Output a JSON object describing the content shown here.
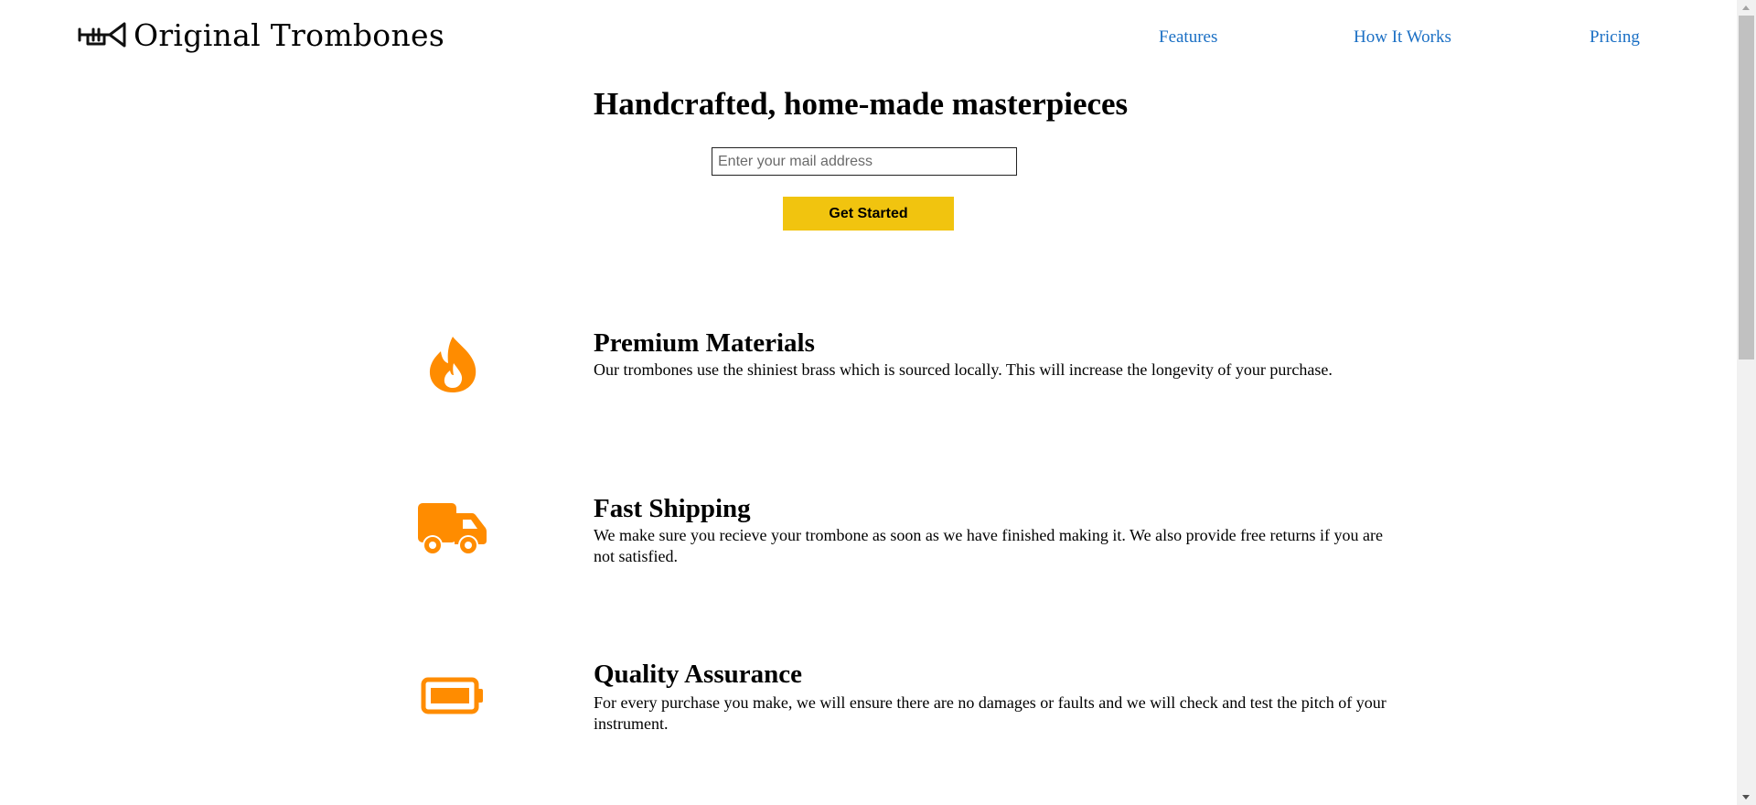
{
  "header": {
    "logo_text": "Original Trombones",
    "logo_icon": "trombone-icon",
    "nav": [
      {
        "label": "Features"
      },
      {
        "label": "How It Works"
      },
      {
        "label": "Pricing"
      }
    ]
  },
  "hero": {
    "title": "Handcrafted, home-made masterpieces",
    "email_placeholder": "Enter your mail address",
    "button_label": "Get Started"
  },
  "features": [
    {
      "icon": "fire-icon",
      "title": "Premium Materials",
      "text": "Our trombones use the shiniest brass which is sourced locally. This will increase the longevity of your purchase."
    },
    {
      "icon": "truck-icon",
      "title": "Fast Shipping",
      "text": "We make sure you recieve your trombone as soon as we have finished making it. We also provide free returns if you are not satisfied."
    },
    {
      "icon": "battery-icon",
      "title": "Quality Assurance",
      "text": "For every purchase you make, we will ensure there are no damages or faults and we will check and test the pitch of your instrument."
    }
  ],
  "colors": {
    "accent": "#f1c40f",
    "icon": "#ff8c00",
    "link": "#1a6fc4"
  }
}
